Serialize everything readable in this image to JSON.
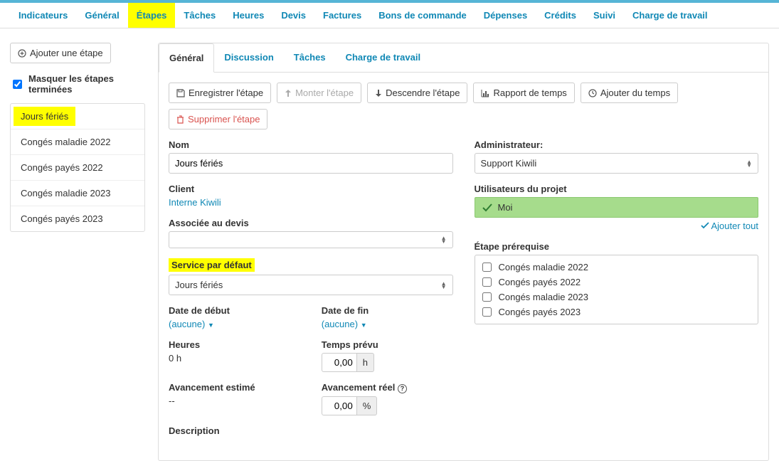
{
  "mainTabs": {
    "items": [
      "Indicateurs",
      "Général",
      "Étapes",
      "Tâches",
      "Heures",
      "Devis",
      "Factures",
      "Bons de commande",
      "Dépenses",
      "Crédits",
      "Suivi",
      "Charge de travail"
    ],
    "activeIndex": 2
  },
  "sidebar": {
    "addButton": "Ajouter une étape",
    "hideCompleted": "Masquer les étapes terminées",
    "steps": [
      "Jours fériés",
      "Congés maladie 2022",
      "Congés payés 2022",
      "Congés maladie 2023",
      "Congés payés 2023"
    ],
    "selectedIndex": 0
  },
  "subTabs": {
    "items": [
      "Général",
      "Discussion",
      "Tâches",
      "Charge de travail"
    ],
    "activeIndex": 0
  },
  "toolbar": {
    "save": "Enregistrer l'étape",
    "up": "Monter l'étape",
    "down": "Descendre l'étape",
    "report": "Rapport de temps",
    "addTime": "Ajouter du temps",
    "delete": "Supprimer l'étape"
  },
  "form": {
    "nameLabel": "Nom",
    "nameValue": "Jours fériés",
    "clientLabel": "Client",
    "clientValue": "Interne Kiwili",
    "quoteLabel": "Associée au devis",
    "quoteValue": "",
    "serviceLabel": "Service par défaut",
    "serviceValue": "Jours fériés",
    "startLabel": "Date de début",
    "startValue": "(aucune)",
    "endLabel": "Date de fin",
    "endValue": "(aucune)",
    "hoursLabel": "Heures",
    "hoursValue": "0 h",
    "plannedLabel": "Temps prévu",
    "plannedValue": "0,00",
    "plannedUnit": "h",
    "estLabel": "Avancement estimé",
    "estValue": "--",
    "realLabel": "Avancement réel",
    "realValue": "0,00",
    "realUnit": "%",
    "descLabel": "Description"
  },
  "right": {
    "adminLabel": "Administrateur:",
    "adminValue": "Support Kiwili",
    "usersLabel": "Utilisateurs du projet",
    "me": "Moi",
    "addAll": "Ajouter tout",
    "prereqLabel": "Étape prérequise",
    "prereqItems": [
      "Congés maladie 2022",
      "Congés payés 2022",
      "Congés maladie 2023",
      "Congés payés 2023"
    ]
  }
}
